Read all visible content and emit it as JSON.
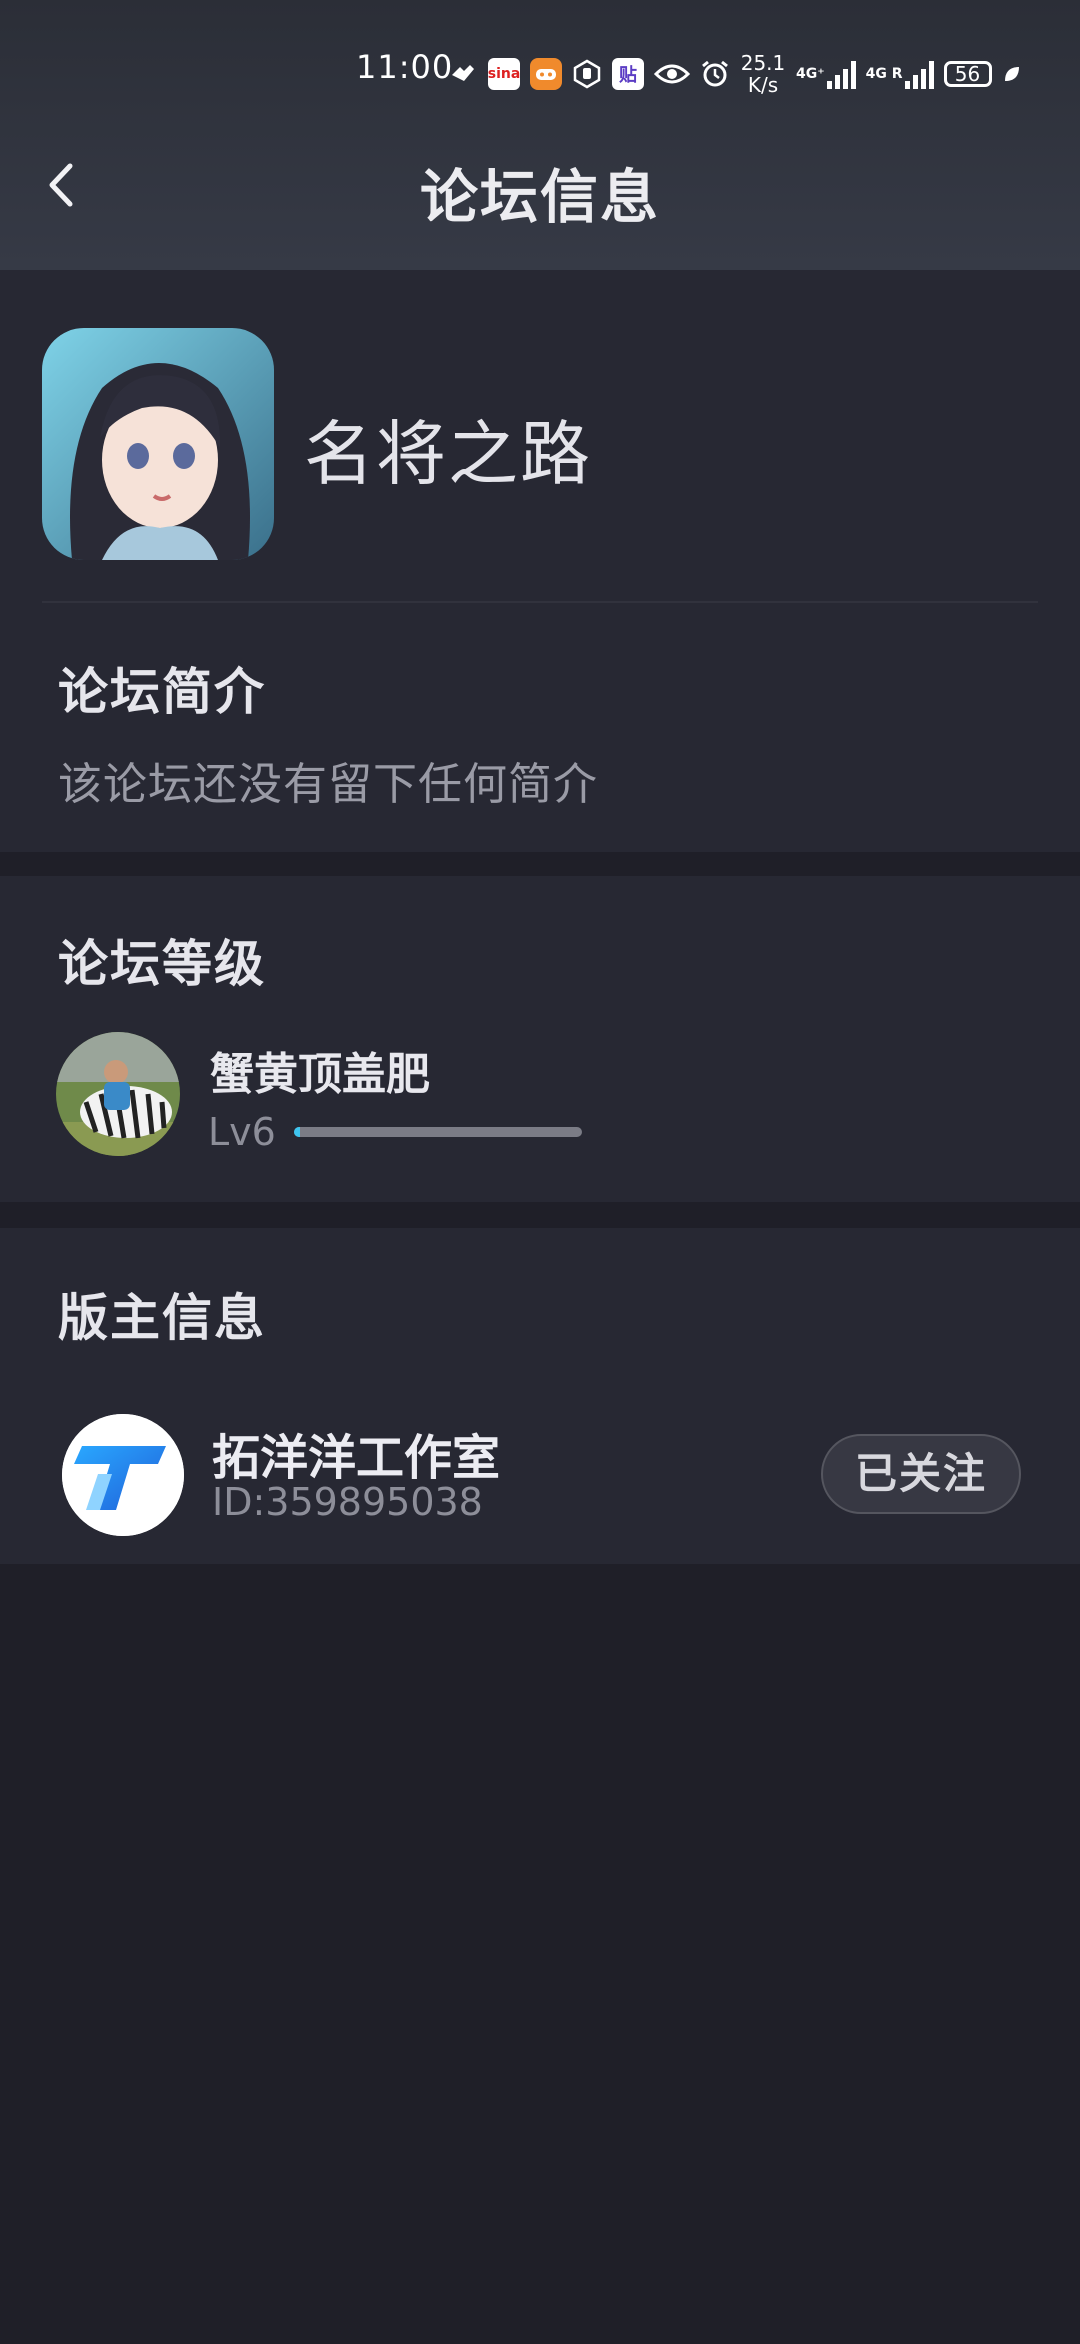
{
  "status_bar": {
    "time": "11:00",
    "net_speed_value": "25.1",
    "net_speed_unit": "K/s",
    "net_type_1": "4G⁺",
    "net_type_2": "4G R",
    "battery": "56",
    "icons": [
      "wave-icon",
      "sina-icon",
      "game-icon",
      "hand-icon",
      "tie-icon",
      "eye-icon",
      "alarm-icon",
      "signal-icon",
      "signal-icon",
      "battery-icon",
      "leaf-icon"
    ]
  },
  "header": {
    "title": "论坛信息"
  },
  "forum": {
    "name": "名将之路",
    "intro_title": "论坛简介",
    "intro_text": "该论坛还没有留下任何简介"
  },
  "level": {
    "section_title": "论坛等级",
    "user_name": "蟹黄顶盖肥",
    "level_label": "Lv6",
    "progress": 0.02
  },
  "moderator": {
    "section_title": "版主信息",
    "name": "拓洋洋工作室",
    "id_text": "ID:359895038",
    "follow_label": "已关注"
  },
  "colors": {
    "background": "#1f1f28",
    "card": "#272833",
    "accent": "#3ec5f0"
  }
}
